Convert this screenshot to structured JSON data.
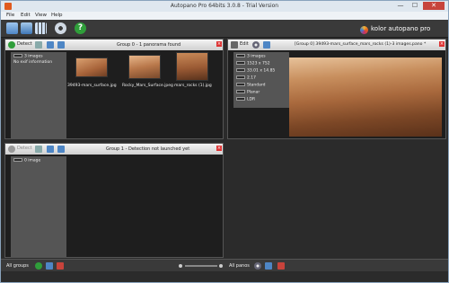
{
  "window": {
    "title": "Autopano Pro 64bits 3.0.8 - Trial Version",
    "min": "—",
    "max": "☐",
    "close": "✕"
  },
  "menu": [
    "File",
    "Edit",
    "View",
    "Help"
  ],
  "toolbar": {
    "brand": "kolor autopano pro"
  },
  "group0": {
    "title": "Group 0 - 1 panorama found",
    "detect_label": "Detect",
    "info": [
      "3 images",
      "No exif information"
    ],
    "images": [
      "39493-mars_surface.jpg",
      "Rocky_Mars_Surface.jpeg",
      "mars_rocks (1).jpg"
    ]
  },
  "group1": {
    "title": "Group 1 - Detection not launched yet",
    "detect_label": "Detect",
    "info": [
      "0 image"
    ]
  },
  "pano": {
    "title": "[Group 0] 39493-mars_surface_mars_rocks (1)-3 images.pano *",
    "edit_label": "Edit",
    "info": [
      "3 images",
      "1523 x 752",
      "33.01 x 14.85",
      "2.17",
      "Standard",
      "Planar",
      "LDR"
    ]
  },
  "status": {
    "left_label": "All groups",
    "right_label": "All panos"
  },
  "colors": {
    "accent": "#c7433b",
    "panel": "#1e1e1e",
    "info": "#555555"
  }
}
